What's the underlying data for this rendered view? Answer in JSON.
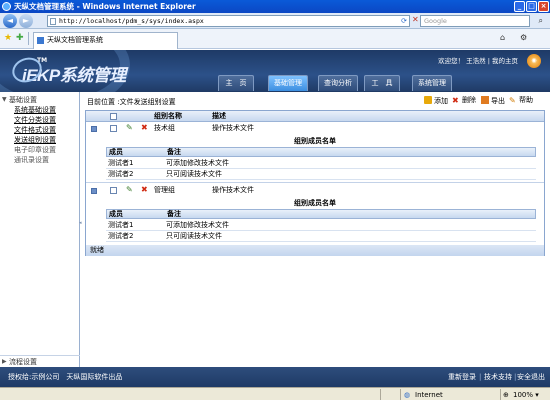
{
  "window": {
    "title": "天纵文档管理系统 - Windows Internet Explorer",
    "minimize": "_",
    "maximize": "□",
    "close": "×"
  },
  "address": {
    "back": "◄",
    "forward": "►",
    "url": "http://localhost/pdm_s/sys/index.aspx",
    "search_placeholder": "Google"
  },
  "browser_tab": {
    "label": "天纵文档管理系统"
  },
  "header": {
    "logo_tm": "TM",
    "logo": "iEKP系统管理",
    "welcome": "欢迎您！ 王浩然 | 我的主页",
    "nav": [
      "主　页",
      "基础管理",
      "查询分析",
      "工　具",
      "系统管理"
    ],
    "active_nav": "基础管理"
  },
  "sidebar": {
    "section_title": "基础设置",
    "items": [
      "系统基础设置",
      "文件分类设置",
      "文件格式设置",
      "发送组别设置",
      "电子印章设置",
      "通讯录设置"
    ],
    "bottom_section": "流程设置"
  },
  "main": {
    "breadcrumb": "目前位置 :文件发送组别设置",
    "toolbar": {
      "add": "添加",
      "delete": "删除",
      "export": "导出",
      "help": "帮助"
    },
    "columns": [
      "组别名称",
      "描述"
    ],
    "groups": [
      {
        "name": "技术组",
        "description": "操作技术文件",
        "member_title": "组别成员名单",
        "member_columns": [
          "成员",
          "备注"
        ],
        "members": [
          {
            "name": "测试者1",
            "note": "可添加修改技术文件"
          },
          {
            "name": "测试者2",
            "note": "只可阅读技术文件"
          }
        ]
      },
      {
        "name": "管理组",
        "description": "操作技术文件",
        "member_title": "组别成员名单",
        "member_columns": [
          "成员",
          "备注"
        ],
        "members": [
          {
            "name": "测试者1",
            "note": "可添加修改技术文件"
          },
          {
            "name": "测试者2",
            "note": "只可阅读技术文件"
          }
        ]
      }
    ],
    "footer_label": "就绪"
  },
  "footer": {
    "copyright": "授权给:示例公司　天纵国际软件出品",
    "links": [
      "重新登录",
      "技术支持",
      "安全退出"
    ]
  },
  "statusbar": {
    "zone": "Internet",
    "zoom": "100%"
  }
}
